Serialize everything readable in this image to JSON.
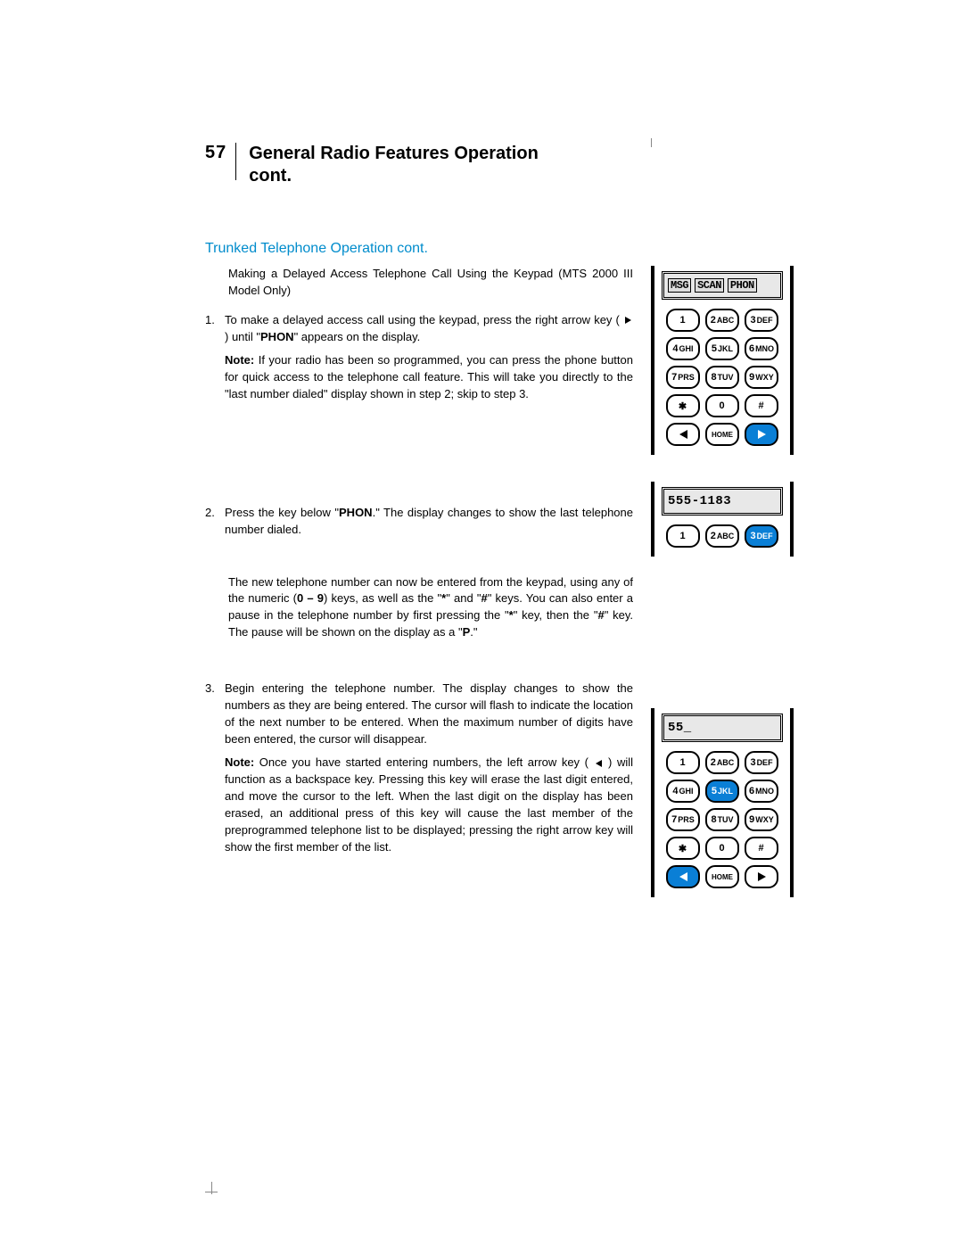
{
  "page_number": "57",
  "page_title_line1": "General Radio Features Operation",
  "page_title_line2": "cont.",
  "subtitle": "Trunked Telephone Operation cont.",
  "intro": "Making a Delayed Access Telephone Call Using the Keypad (MTS 2000 III Model Only)",
  "step1_num": "1.",
  "step1_a_pre": "To make a delayed access call using the keypad, press the right arrow key ( ",
  "step1_a_post": " ) until \"",
  "step1_a_bold": "PHON",
  "step1_a_end": "\" appears on the display.",
  "step1_note_label": "Note:",
  "step1_note": " If your radio has been so programmed, you can press the phone button for quick access to the telephone call feature. This will take you directly to the \"last number dialed\" display shown in step 2; skip to step 3.",
  "step2_num": "2.",
  "step2_a_pre": "Press the key below \"",
  "step2_a_bold": "PHON",
  "step2_a_post": ".\" The display changes to show the last telephone number dialed.",
  "step2_b_pre": "The new telephone number can now be entered from the keypad, using any of the numeric ",
  "step2_b_bold1": "0 – 9",
  "step2_b_mid": ") keys, as well as the \"",
  "step2_b_star": "*",
  "step2_b_mid2": "\" and \"",
  "step2_b_hash": "#",
  "step2_b_mid3": "\" keys. You can also enter a pause in the telephone number by first pressing the \"",
  "step2_b_mid4": "\" key, then the \"",
  "step2_b_mid5": "\" key. The pause will be shown on the display as a \"",
  "step2_b_p": "P",
  "step2_b_end": ".\"",
  "step3_num": "3.",
  "step3_a": "Begin entering the telephone number. The display changes to show the numbers as they are being entered. The cursor will flash to indicate the location of the next number to be entered. When the maximum number of digits have been entered, the cursor will disappear.",
  "step3_note_label": "Note:",
  "step3_note_pre": " Once you have started entering numbers, the left arrow key ( ",
  "step3_note_post": " ) will function as a backspace key. Pressing this key will erase the last digit entered, and move the cursor to the left. When the last digit on the display has been erased, an additional press of this key will cause the last member of the preprogrammed telephone list to be displayed; pressing the right arrow key will show the first member of the list.",
  "kp1_screen1": "MSG",
  "kp1_screen2": "SCAN",
  "kp1_screen3": "PHON",
  "kp2_screen": "555-1183",
  "kp3_screen": "55_",
  "keys": {
    "k1": "1",
    "k2n": "2",
    "k2l": "ABC",
    "k3n": "3",
    "k3l": "DEF",
    "k4n": "4",
    "k4l": "GHI",
    "k5n": "5",
    "k5l": "JKL",
    "k6n": "6",
    "k6l": "MNO",
    "k7n": "7",
    "k7l": "PRS",
    "k8n": "8",
    "k8l": "TUV",
    "k9n": "9",
    "k9l": "WXY",
    "star": "✱",
    "k0": "0",
    "hash": "#",
    "home": "HOME"
  }
}
